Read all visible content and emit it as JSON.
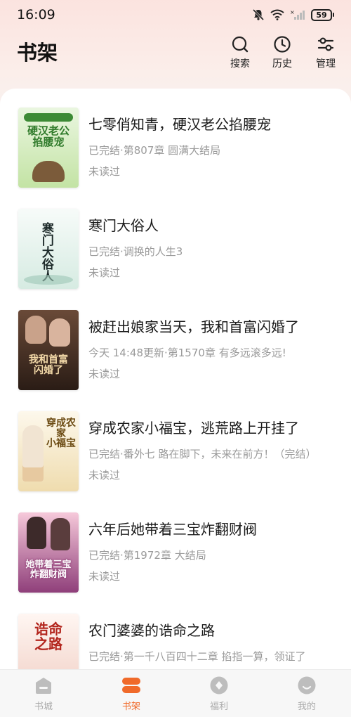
{
  "status_bar": {
    "time": "16:09",
    "battery": "59"
  },
  "header": {
    "title": "书架",
    "actions": [
      {
        "label": "搜索",
        "icon": "search-icon"
      },
      {
        "label": "历史",
        "icon": "history-clock-icon"
      },
      {
        "label": "管理",
        "icon": "manage-sliders-icon"
      }
    ]
  },
  "books": [
    {
      "title": "七零俏知青，硬汉老公掐腰宠",
      "meta": "已完结·第807章 圆满大结局",
      "progress": "未读过",
      "cover_text": "硬汉老公掐腰宠",
      "cover_colors": [
        "#e9f5e0",
        "#b9df9c"
      ],
      "cover_text_color": "#2f7a2a"
    },
    {
      "title": "寒门大俗人",
      "meta": "已完结·调换的人生3",
      "progress": "未读过",
      "cover_text": "寒门大俗人",
      "cover_colors": [
        "#f4f8f6",
        "#d9ebe4"
      ],
      "cover_text_color": "#1d2a2a"
    },
    {
      "title": "被赶出娘家当天，我和首富闪婚了",
      "meta": "今天 14:48更新·第1570章 有多远滚多远!",
      "progress": "未读过",
      "cover_text": "我和首富闪婚了",
      "cover_colors": [
        "#4a3428",
        "#1e1410"
      ],
      "cover_text_color": "#f3d9a8"
    },
    {
      "title": "穿成农家小福宝，逃荒路上开挂了",
      "meta": "已完结·番外七 路在脚下，未来在前方！（完结）",
      "progress": "未读过",
      "cover_text": "穿成农家小福宝",
      "cover_colors": [
        "#fbf5e6",
        "#eed9a6"
      ],
      "cover_text_color": "#6b4a12"
    },
    {
      "title": "六年后她带着三宝炸翻财阀",
      "meta": "已完结·第1972章 大结局",
      "progress": "未读过",
      "cover_text": "她带着三宝炸翻财阀",
      "cover_colors": [
        "#f2b8d0",
        "#a34c86"
      ],
      "cover_text_color": "#ffffff"
    },
    {
      "title": "农门婆婆的诰命之路",
      "meta": "已完结·第一千八百四十二章 掐指一算，领证了",
      "progress": "",
      "cover_text": "诰命之路",
      "cover_colors": [
        "#fdf2ee",
        "#f4d2c8"
      ],
      "cover_text_color": "#b3261e"
    }
  ],
  "tabs": [
    {
      "label": "书城",
      "icon": "bookstore-icon",
      "active": false
    },
    {
      "label": "书架",
      "icon": "bookshelf-icon",
      "active": true
    },
    {
      "label": "福利",
      "icon": "welfare-icon",
      "active": false
    },
    {
      "label": "我的",
      "icon": "profile-icon",
      "active": false
    }
  ],
  "colors": {
    "accent": "#f06a2a",
    "inactive_tab": "#b5b5b5"
  }
}
